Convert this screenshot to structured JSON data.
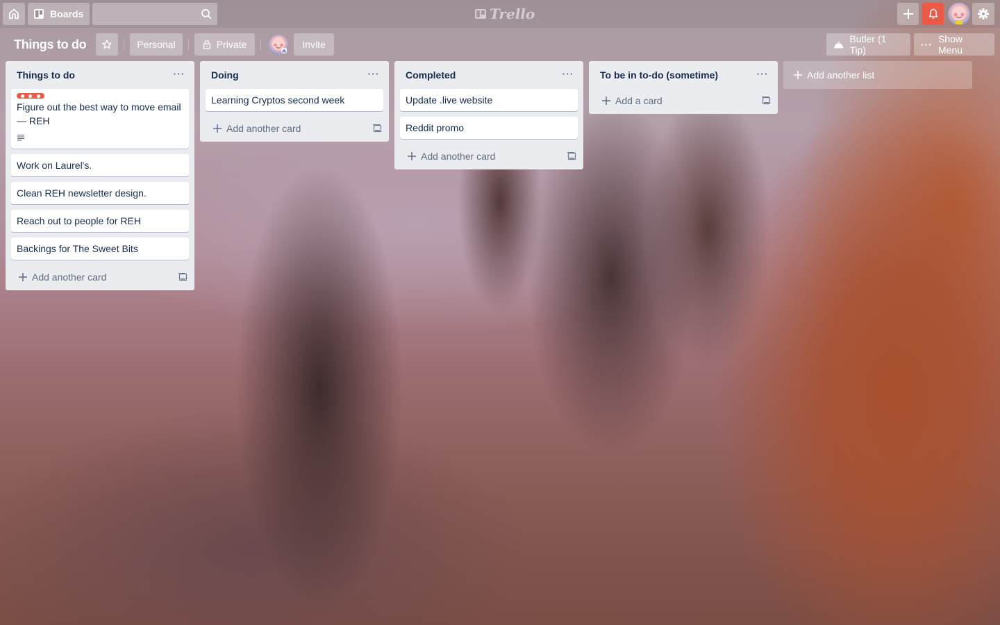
{
  "topbar": {
    "home_icon": "home-icon",
    "boards_label": "Boards",
    "search_placeholder": "",
    "logo_text": "Trello",
    "add_icon": "plus-icon",
    "notifications_icon": "bell-icon",
    "settings_icon": "gear-icon",
    "notification_color": "#eb5a46"
  },
  "board": {
    "title": "Things to do",
    "personal_label": "Personal",
    "visibility_label": "Private",
    "invite_label": "Invite",
    "butler_label": "Butler (1 Tip)",
    "menu_label": "Show Menu"
  },
  "lists": [
    {
      "title": "Things to do",
      "cards": [
        {
          "text": "Figure out the best way to move email — REH",
          "label_color": "#eb5a46",
          "has_description": true
        },
        {
          "text": "Work on Laurel's."
        },
        {
          "text": "Clean REH newsletter design."
        },
        {
          "text": "Reach out to people for REH"
        },
        {
          "text": "Backings for The Sweet Bits"
        }
      ],
      "add_label": "Add another card"
    },
    {
      "title": "Doing",
      "cards": [
        {
          "text": "Learning Cryptos second week"
        }
      ],
      "add_label": "Add another card"
    },
    {
      "title": "Completed",
      "cards": [
        {
          "text": "Update .live website"
        },
        {
          "text": "Reddit promo"
        }
      ],
      "add_label": "Add another card"
    },
    {
      "title": "To be in to-do (sometime)",
      "cards": [],
      "add_label": "Add a card"
    }
  ],
  "add_list_label": "Add another list"
}
